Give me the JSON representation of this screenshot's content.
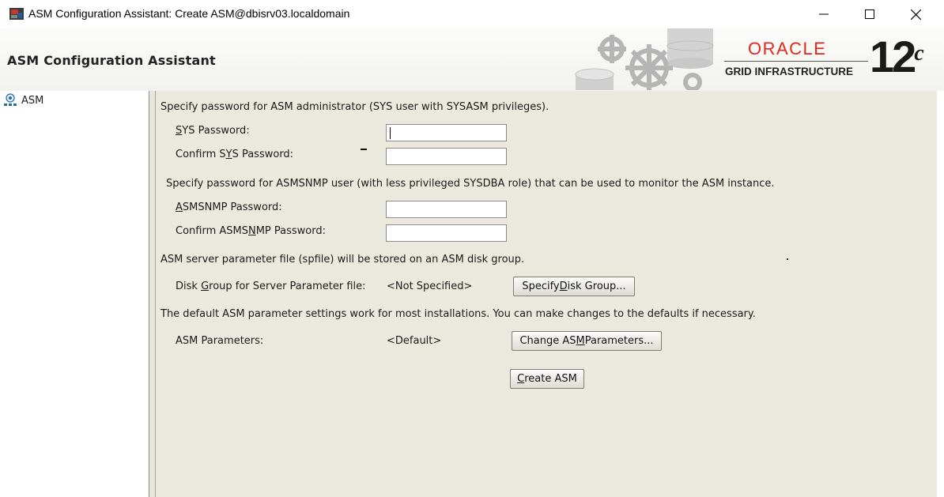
{
  "window": {
    "title": "ASM Configuration Assistant: Create ASM@dbisrv03.localdomain"
  },
  "banner": {
    "app_title": "ASM Configuration Assistant",
    "logo_word": "ORACLE",
    "logo_sub": "GRID INFRASTRUCTURE",
    "logo_version": "12",
    "logo_version_sup": "c"
  },
  "nav": {
    "items": [
      {
        "label": "ASM",
        "icon": "asm-instance-icon"
      }
    ]
  },
  "form": {
    "sys_section": "Specify password for ASM administrator (SYS user with SYSASM privileges).",
    "sys_password": {
      "label_mnemonic": "S",
      "label_rest": "YS Password:",
      "value": ""
    },
    "confirm_sys_password": {
      "label_pre": "Confirm S",
      "label_mnemonic": "Y",
      "label_rest": "S Password:",
      "value": ""
    },
    "snmp_section": "Specify password for ASMSNMP user (with less privileged SYSDBA role) that can be used to monitor the ASM instance.",
    "asmsnmp_password": {
      "label_mnemonic": "A",
      "label_rest": "SMSNMP Password:",
      "value": ""
    },
    "confirm_asmsnmp_password": {
      "label_pre": "Confirm ASMS",
      "label_mnemonic": "N",
      "label_rest": "MP Password:",
      "value": ""
    },
    "spfile_section": "ASM server parameter file (spfile) will be stored on an ASM disk group.",
    "disk_group": {
      "label_pre": "Disk ",
      "label_mnemonic": "G",
      "label_rest": "roup for Server Parameter file:",
      "value": "<Not Specified>",
      "button_pre": "Specify ",
      "button_mnemonic": "D",
      "button_rest": "isk Group..."
    },
    "params_section": "The default ASM parameter settings work for most installations. You can make changes to the defaults if necessary.",
    "asm_parameters": {
      "label": "ASM Parameters:",
      "value": "<Default>",
      "button_pre": "Change AS",
      "button_mnemonic": "M",
      "button_rest": " Parameters..."
    },
    "create_button": {
      "mnemonic": "C",
      "rest": "reate ASM"
    }
  },
  "colors": {
    "content_bg": "#ebe9dd",
    "oracle_red": "#e0281b"
  }
}
